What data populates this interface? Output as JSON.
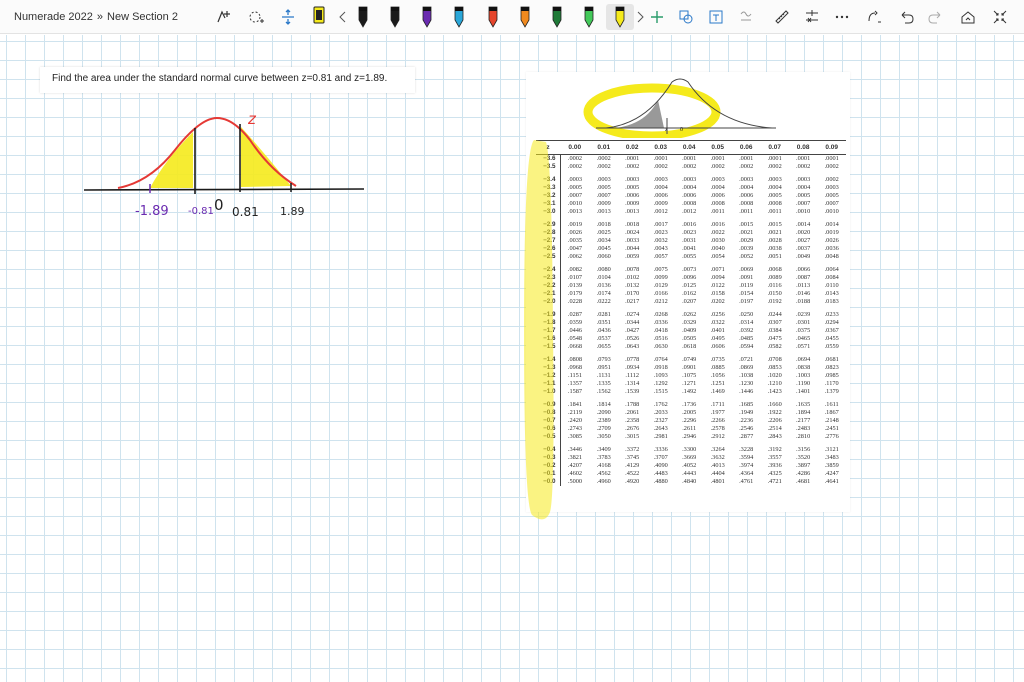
{
  "breadcrumb": {
    "notebook": "Numerade 2022",
    "separator": "»",
    "section": "New Section 2"
  },
  "toolbar": {
    "tools": [
      "lasso-select-icon",
      "add-space-icon",
      "insert-space-icon"
    ],
    "pens": [
      {
        "name": "black-pen",
        "color": "#1a1a1a"
      },
      {
        "name": "black-pen-2",
        "color": "#1a1a1a"
      },
      {
        "name": "purple-pen",
        "color": "#6a2bb0"
      },
      {
        "name": "blue-pen",
        "color": "#2aa7d9"
      },
      {
        "name": "red-pen",
        "color": "#e5452c"
      },
      {
        "name": "orange-pen",
        "color": "#f08a1f"
      },
      {
        "name": "dark-green-pen",
        "color": "#1f7a38"
      },
      {
        "name": "green-highlighter",
        "color": "#43c95a"
      },
      {
        "name": "yellow-highlighter",
        "color": "#f5ea1c"
      }
    ],
    "right_tools": [
      "ink-to-shape-icon",
      "ink-to-text-icon",
      "ink-to-math-icon",
      "ruler-icon",
      "math-icon",
      "more-icon",
      "replay-icon",
      "undo-icon",
      "redo-icon",
      "full-page-icon",
      "fullscreen-icon"
    ]
  },
  "prompt": {
    "text": "Find the area under the standard normal curve between z=0.81 and z=1.89."
  },
  "sketch": {
    "labels": {
      "neg189": "-1.89",
      "neg081": "-0.81",
      "zero": "0",
      "pos081": "0.81",
      "pos189": "1.89",
      "z": "z"
    }
  },
  "ztable": {
    "inset_labels": {
      "z": "z",
      "zero": "0"
    },
    "header": [
      "z",
      ".00",
      ".01",
      ".02",
      ".03",
      ".04",
      ".05",
      ".06",
      ".07",
      ".08",
      ".09"
    ],
    "header_display": [
      "z",
      "0.00",
      "0.01",
      "0.02",
      "0.03",
      "0.04",
      "0.05",
      "0.06",
      "0.07",
      "0.08",
      "0.09"
    ],
    "rows": [
      [
        "−3.6",
        ".0002",
        ".0002",
        ".0001",
        ".0001",
        ".0001",
        ".0001",
        ".0001",
        ".0001",
        ".0001",
        ".0001"
      ],
      [
        "−3.5",
        ".0002",
        ".0002",
        ".0002",
        ".0002",
        ".0002",
        ".0002",
        ".0002",
        ".0002",
        ".0002",
        ".0002"
      ],
      [
        "−3.4",
        ".0003",
        ".0003",
        ".0003",
        ".0003",
        ".0003",
        ".0003",
        ".0003",
        ".0003",
        ".0003",
        ".0002"
      ],
      [
        "−3.3",
        ".0005",
        ".0005",
        ".0005",
        ".0004",
        ".0004",
        ".0004",
        ".0004",
        ".0004",
        ".0004",
        ".0003"
      ],
      [
        "−3.2",
        ".0007",
        ".0007",
        ".0006",
        ".0006",
        ".0006",
        ".0006",
        ".0006",
        ".0005",
        ".0005",
        ".0005"
      ],
      [
        "−3.1",
        ".0010",
        ".0009",
        ".0009",
        ".0009",
        ".0008",
        ".0008",
        ".0008",
        ".0008",
        ".0007",
        ".0007"
      ],
      [
        "−3.0",
        ".0013",
        ".0013",
        ".0013",
        ".0012",
        ".0012",
        ".0011",
        ".0011",
        ".0011",
        ".0010",
        ".0010"
      ],
      [
        "−2.9",
        ".0019",
        ".0018",
        ".0018",
        ".0017",
        ".0016",
        ".0016",
        ".0015",
        ".0015",
        ".0014",
        ".0014"
      ],
      [
        "−2.8",
        ".0026",
        ".0025",
        ".0024",
        ".0023",
        ".0023",
        ".0022",
        ".0021",
        ".0021",
        ".0020",
        ".0019"
      ],
      [
        "−2.7",
        ".0035",
        ".0034",
        ".0033",
        ".0032",
        ".0031",
        ".0030",
        ".0029",
        ".0028",
        ".0027",
        ".0026"
      ],
      [
        "−2.6",
        ".0047",
        ".0045",
        ".0044",
        ".0043",
        ".0041",
        ".0040",
        ".0039",
        ".0038",
        ".0037",
        ".0036"
      ],
      [
        "−2.5",
        ".0062",
        ".0060",
        ".0059",
        ".0057",
        ".0055",
        ".0054",
        ".0052",
        ".0051",
        ".0049",
        ".0048"
      ],
      [
        "−2.4",
        ".0082",
        ".0080",
        ".0078",
        ".0075",
        ".0073",
        ".0071",
        ".0069",
        ".0068",
        ".0066",
        ".0064"
      ],
      [
        "−2.3",
        ".0107",
        ".0104",
        ".0102",
        ".0099",
        ".0096",
        ".0094",
        ".0091",
        ".0089",
        ".0087",
        ".0084"
      ],
      [
        "−2.2",
        ".0139",
        ".0136",
        ".0132",
        ".0129",
        ".0125",
        ".0122",
        ".0119",
        ".0116",
        ".0113",
        ".0110"
      ],
      [
        "−2.1",
        ".0179",
        ".0174",
        ".0170",
        ".0166",
        ".0162",
        ".0158",
        ".0154",
        ".0150",
        ".0146",
        ".0143"
      ],
      [
        "−2.0",
        ".0228",
        ".0222",
        ".0217",
        ".0212",
        ".0207",
        ".0202",
        ".0197",
        ".0192",
        ".0188",
        ".0183"
      ],
      [
        "−1.9",
        ".0287",
        ".0281",
        ".0274",
        ".0268",
        ".0262",
        ".0256",
        ".0250",
        ".0244",
        ".0239",
        ".0233"
      ],
      [
        "−1.8",
        ".0359",
        ".0351",
        ".0344",
        ".0336",
        ".0329",
        ".0322",
        ".0314",
        ".0307",
        ".0301",
        ".0294"
      ],
      [
        "−1.7",
        ".0446",
        ".0436",
        ".0427",
        ".0418",
        ".0409",
        ".0401",
        ".0392",
        ".0384",
        ".0375",
        ".0367"
      ],
      [
        "−1.6",
        ".0548",
        ".0537",
        ".0526",
        ".0516",
        ".0505",
        ".0495",
        ".0485",
        ".0475",
        ".0465",
        ".0455"
      ],
      [
        "−1.5",
        ".0668",
        ".0655",
        ".0643",
        ".0630",
        ".0618",
        ".0606",
        ".0594",
        ".0582",
        ".0571",
        ".0559"
      ],
      [
        "−1.4",
        ".0808",
        ".0793",
        ".0778",
        ".0764",
        ".0749",
        ".0735",
        ".0721",
        ".0708",
        ".0694",
        ".0681"
      ],
      [
        "−1.3",
        ".0968",
        ".0951",
        ".0934",
        ".0918",
        ".0901",
        ".0885",
        ".0869",
        ".0853",
        ".0838",
        ".0823"
      ],
      [
        "−1.2",
        ".1151",
        ".1131",
        ".1112",
        ".1093",
        ".1075",
        ".1056",
        ".1038",
        ".1020",
        ".1003",
        ".0985"
      ],
      [
        "−1.1",
        ".1357",
        ".1335",
        ".1314",
        ".1292",
        ".1271",
        ".1251",
        ".1230",
        ".1210",
        ".1190",
        ".1170"
      ],
      [
        "−1.0",
        ".1587",
        ".1562",
        ".1539",
        ".1515",
        ".1492",
        ".1469",
        ".1446",
        ".1423",
        ".1401",
        ".1379"
      ],
      [
        "−0.9",
        ".1841",
        ".1814",
        ".1788",
        ".1762",
        ".1736",
        ".1711",
        ".1685",
        ".1660",
        ".1635",
        ".1611"
      ],
      [
        "−0.8",
        ".2119",
        ".2090",
        ".2061",
        ".2033",
        ".2005",
        ".1977",
        ".1949",
        ".1922",
        ".1894",
        ".1867"
      ],
      [
        "−0.7",
        ".2420",
        ".2389",
        ".2358",
        ".2327",
        ".2296",
        ".2266",
        ".2236",
        ".2206",
        ".2177",
        ".2148"
      ],
      [
        "−0.6",
        ".2743",
        ".2709",
        ".2676",
        ".2643",
        ".2611",
        ".2578",
        ".2546",
        ".2514",
        ".2483",
        ".2451"
      ],
      [
        "−0.5",
        ".3085",
        ".3050",
        ".3015",
        ".2981",
        ".2946",
        ".2912",
        ".2877",
        ".2843",
        ".2810",
        ".2776"
      ],
      [
        "−0.4",
        ".3446",
        ".3409",
        ".3372",
        ".3336",
        ".3300",
        ".3264",
        ".3228",
        ".3192",
        ".3156",
        ".3121"
      ],
      [
        "−0.3",
        ".3821",
        ".3783",
        ".3745",
        ".3707",
        ".3669",
        ".3632",
        ".3594",
        ".3557",
        ".3520",
        ".3483"
      ],
      [
        "−0.2",
        ".4207",
        ".4168",
        ".4129",
        ".4090",
        ".4052",
        ".4013",
        ".3974",
        ".3936",
        ".3897",
        ".3859"
      ],
      [
        "−0.1",
        ".4602",
        ".4562",
        ".4522",
        ".4483",
        ".4443",
        ".4404",
        ".4364",
        ".4325",
        ".4286",
        ".4247"
      ],
      [
        "−0.0",
        ".5000",
        ".4960",
        ".4920",
        ".4880",
        ".4840",
        ".4801",
        ".4761",
        ".4721",
        ".4681",
        ".4641"
      ]
    ],
    "group_starts": [
      2,
      7,
      12,
      17,
      22,
      27,
      32
    ]
  },
  "colors": {
    "highlight": "#f5ea1c",
    "curve": "#e53935",
    "ink": "#1a1a1a",
    "purple": "#6a2bb0",
    "grid": "#cfe3ee"
  }
}
